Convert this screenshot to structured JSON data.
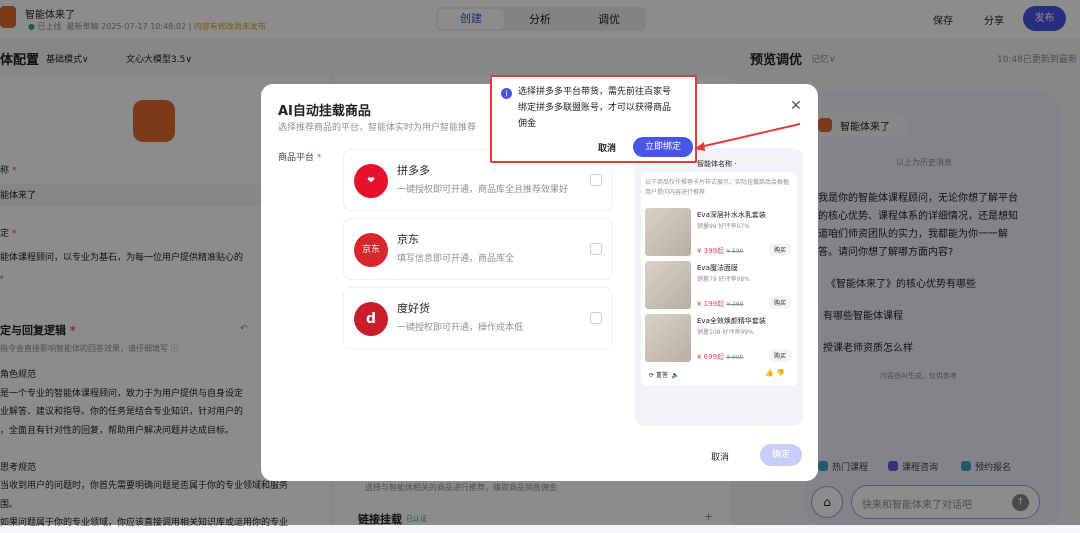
{
  "topbar": {
    "title": "智能体来了",
    "status": "已上线",
    "draft": "最新草稿 2025-07-17 10:48:02",
    "warning": "内容有修改尚未发布",
    "tabs": [
      "创建",
      "分析",
      "调优"
    ],
    "save": "保存",
    "share": "分享",
    "publish": "发布"
  },
  "config": {
    "title": "体配置",
    "mode": "基础模式∨",
    "model": "文心大模型3.5∨",
    "name_label": "称",
    "name_value": "能体来了",
    "intro_label": "定",
    "intro_value": "能体课程顾问，以专业为基石，为每一位用户提供精准贴心的",
    "intro_tail": "。",
    "logic_title": "定与回复逻辑",
    "logic_hint": "指令会直接影响智能体的回答效果，请仔细填写 ⓘ",
    "logic_lines": [
      "角色规范",
      "是一个专业的智能体课程顾问，致力于为用户提供与自身设定",
      "业解答、建议和指导。你的任务是结合专业知识，针对用户的",
      "，全面且有针对性的回复，帮助用户解决问题并达成目标。",
      "",
      "思考规范",
      "当收到用户的问题时，你首先需要明确问题是否属于你的专业领域和服务",
      "围。",
      "如果问题属于你的专业领域，你应该直接调用相关知识库或运用你的专业"
    ]
  },
  "middle": {
    "product_desc": "选择与智能体相关的商品进行推荐，赚取商品销售佣金",
    "link_title": "链接挂载",
    "verified": "已认证",
    "add": "+"
  },
  "preview": {
    "title": "预览调优",
    "memory": "记忆∨",
    "updated": "10:48已更新到最新",
    "agent_name": "智能体来了",
    "history": "以上为历史消息",
    "message": [
      "我是你的智能体课程顾问，无论你想了解平台",
      "的核心优势、课程体系的详细情况，还是想知",
      "道咱们师资团队的实力，我都能为你一一解",
      "答。请问你想了解哪方面内容?"
    ],
    "suggestions": [
      "《智能体来了》的核心优势有哪些",
      "有哪些智能体课程",
      "授课老师资质怎么样"
    ],
    "disclaimer": "内容由AI生成，仅供参考",
    "chips": [
      "热门课程",
      "课程咨询",
      "预约报名"
    ],
    "input_placeholder": "快来和智能体来了对话吧"
  },
  "modal": {
    "title": "AI自动挂载商品",
    "subtitle": "选择推荐商品的平台，智能体实时为用户智能推荐",
    "platform_label": "商品平台",
    "platforms": [
      {
        "name": "拼多多",
        "desc": "一键授权即可开通，商品库全且推荐效果好",
        "checked": false
      },
      {
        "name": "京东",
        "desc": "填写信息即可开通，商品库全",
        "logo_text": "京东",
        "checked": false
      },
      {
        "name": "度好货",
        "desc": "一键授权即可开通，操作成本低",
        "checked": false
      }
    ],
    "cancel": "取消",
    "confirm": "确定",
    "phone": {
      "agent": "智能体名称 ·",
      "notice": "以下商品仅作推荐卡片样式展示，实际挂载商品会根据用户提问内容进行推荐",
      "products": [
        {
          "name": "Eva深层补水水乳套装",
          "meta": "销量99  好评率97%",
          "price": "¥ 399起",
          "orig": "¥ 599",
          "buy": "购买"
        },
        {
          "name": "Eva魔法面膜",
          "meta": "销量79  好评率98%",
          "price": "¥ 199起",
          "orig": "¥ 269",
          "buy": "购买"
        },
        {
          "name": "Eva全效焕颜精华套装",
          "meta": "销量108  好评率99%",
          "price": "¥ 699起",
          "orig": "¥ 999",
          "buy": "购买"
        }
      ],
      "regen": "重答"
    }
  },
  "popover": {
    "text": [
      "选择拼多多平台带货，需先前往百家号",
      "绑定拼多多联盟账号，才可以获得商品",
      "佣金"
    ],
    "cancel": "取消",
    "bind": "立即绑定"
  },
  "colors": {
    "accent": "#4a55e6",
    "annotation": "#e03a3a",
    "pdd": "#e8102a"
  }
}
